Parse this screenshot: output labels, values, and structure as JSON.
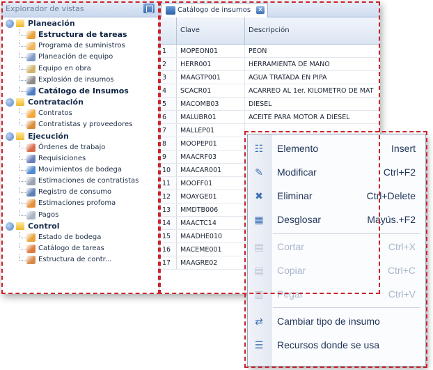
{
  "left_pane": {
    "header": "Explorador de vistas",
    "groups": [
      {
        "label": "Planeación",
        "items": [
          {
            "label": "Estructura de tareas",
            "bold": true,
            "icon": "structure-icon",
            "color": "#e8a23a"
          },
          {
            "label": "Programa de suministros",
            "icon": "program-icon",
            "color": "#f0b45a"
          },
          {
            "label": "Planeación de equipo",
            "icon": "equipment-plan-icon",
            "color": "#7e9ac7"
          },
          {
            "label": "Equipo en obra",
            "icon": "equipment-icon",
            "color": "#d2b36b"
          },
          {
            "label": "Explosión de insumos",
            "icon": "explosion-icon",
            "color": "#8b8b8b"
          },
          {
            "label": "Catálogo de Insumos",
            "bold": true,
            "icon": "catalog-icon",
            "color": "#4a7bc4"
          }
        ]
      },
      {
        "label": "Contratación",
        "items": [
          {
            "label": "Contratos",
            "icon": "contracts-icon",
            "color": "#f2a73b"
          },
          {
            "label": "Contratistas y proveedores",
            "icon": "contractors-icon",
            "color": "#d98c3a"
          }
        ]
      },
      {
        "label": "Ejecución",
        "items": [
          {
            "label": "Órdenes de trabajo",
            "icon": "orders-icon",
            "color": "#d96a4a"
          },
          {
            "label": "Requisiciones",
            "icon": "requisitions-icon",
            "color": "#6b7fb8"
          },
          {
            "label": "Movimientos de bodega",
            "icon": "warehouse-moves-icon",
            "color": "#4e89d1"
          },
          {
            "label": "Estimaciones de contratistas",
            "icon": "estimates-icon",
            "color": "#9aa3b1"
          },
          {
            "label": "Registro de consumo",
            "icon": "consumption-icon",
            "color": "#5d7fb3"
          },
          {
            "label": "Estimaciones profoma",
            "icon": "proforma-icon",
            "color": "#e3913b"
          },
          {
            "label": "Pagos",
            "icon": "payments-icon",
            "color": "#a9b4c4"
          }
        ]
      },
      {
        "label": "Control",
        "items": [
          {
            "label": "Estado de bodega",
            "icon": "warehouse-state-icon",
            "color": "#e8a33f"
          },
          {
            "label": "Catálogo de tareas",
            "icon": "tasks-catalog-icon",
            "color": "#e07b3a"
          },
          {
            "label": "Estructura de contr...",
            "icon": "contract-structure-icon",
            "color": "#d88c4a"
          }
        ]
      }
    ]
  },
  "right_pane": {
    "tab_label": "Catálogo de insumos",
    "columns": {
      "clave": "Clave",
      "descripcion": "Descripción"
    },
    "rows": [
      {
        "n": "1",
        "clave": "MOPEON01",
        "desc": "PEON"
      },
      {
        "n": "2",
        "clave": "HERR001",
        "desc": "HERRAMIENTA DE MANO"
      },
      {
        "n": "3",
        "clave": "MAAGTP001",
        "desc": "AGUA TRATADA EN PIPA"
      },
      {
        "n": "4",
        "clave": "SCACR01",
        "desc": "ACARREO AL 1er. KILOMETRO DE MAT"
      },
      {
        "n": "5",
        "clave": "MACOMB03",
        "desc": "DIESEL"
      },
      {
        "n": "6",
        "clave": "MALUBR01",
        "desc": "ACEITE PARA MOTOR A DIESEL"
      },
      {
        "n": "7",
        "clave": "MALLEP01",
        "desc": ""
      },
      {
        "n": "8",
        "clave": "MOOPEP01",
        "desc": ""
      },
      {
        "n": "9",
        "clave": "MAACRF03",
        "desc": ""
      },
      {
        "n": "10",
        "clave": "MAACAR001",
        "desc": ""
      },
      {
        "n": "11",
        "clave": "MOOFF01",
        "desc": ""
      },
      {
        "n": "12",
        "clave": "MOAYGE01",
        "desc": ""
      },
      {
        "n": "13",
        "clave": "MMDTB006",
        "desc": ""
      },
      {
        "n": "14",
        "clave": "MAACTC14",
        "desc": ""
      },
      {
        "n": "15",
        "clave": "MAADHE010",
        "desc": ""
      },
      {
        "n": "16",
        "clave": "MACEME001",
        "desc": ""
      },
      {
        "n": "17",
        "clave": "MAAGRE02",
        "desc": ""
      }
    ]
  },
  "context_menu": {
    "items": [
      {
        "label": "Elemento",
        "shortcut": "Insert",
        "icon": "insert-icon",
        "enabled": true
      },
      {
        "label": "Modificar",
        "shortcut": "Ctrl+F2",
        "icon": "edit-icon",
        "enabled": true
      },
      {
        "label": "Eliminar",
        "shortcut": "Ctrl+Delete",
        "icon": "delete-icon",
        "enabled": true
      },
      {
        "label": "Desglosar",
        "shortcut": "Mayús.+F2",
        "icon": "breakdown-icon",
        "enabled": true
      },
      {
        "label": "Cortar",
        "shortcut": "Ctrl+X",
        "icon": "cut-icon",
        "enabled": false
      },
      {
        "label": "Copiar",
        "shortcut": "Ctrl+C",
        "icon": "copy-icon",
        "enabled": false
      },
      {
        "label": "Pegar",
        "shortcut": "Ctrl+V",
        "icon": "paste-icon",
        "enabled": false
      },
      {
        "label": "Cambiar tipo de insumo",
        "shortcut": "",
        "icon": "change-type-icon",
        "enabled": true
      },
      {
        "label": "Recursos donde se usa",
        "shortcut": "",
        "icon": "resources-icon",
        "enabled": true
      }
    ]
  },
  "colors": {
    "highlight_dash": "#c8252c",
    "accent": "#3d6fb7",
    "menu_text": "#1e3457",
    "menu_disabled": "#a9b6ca"
  }
}
